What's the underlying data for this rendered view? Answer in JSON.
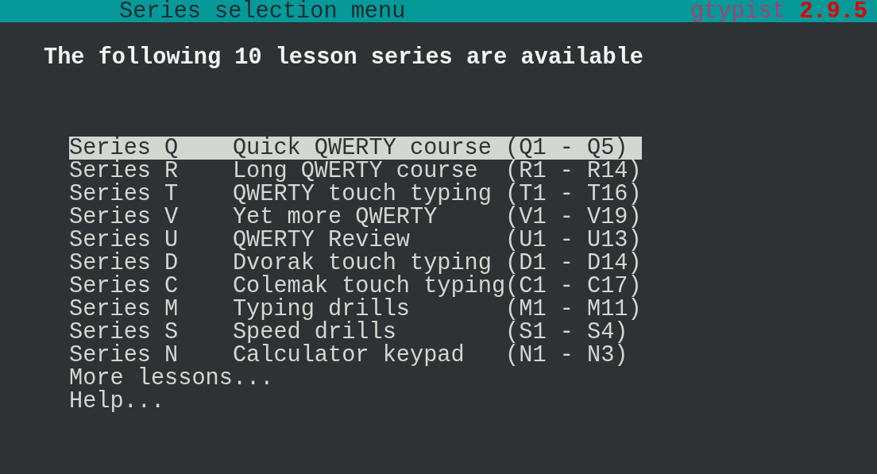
{
  "title_bar": {
    "title": "Series selection menu",
    "app_name": "gtypist",
    "version": "2.9.5"
  },
  "heading": "The following 10 lesson series are available",
  "menu": [
    {
      "kind": "series",
      "name": "Series Q",
      "description": "Quick QWERTY course",
      "range": "(Q1 - Q5)",
      "selected": true
    },
    {
      "kind": "series",
      "name": "Series R",
      "description": "Long QWERTY course",
      "range": "(R1 - R14)",
      "selected": false
    },
    {
      "kind": "series",
      "name": "Series T",
      "description": "QWERTY touch typing",
      "range": "(T1 - T16)",
      "selected": false
    },
    {
      "kind": "series",
      "name": "Series V",
      "description": "Yet more QWERTY",
      "range": "(V1 - V19)",
      "selected": false
    },
    {
      "kind": "series",
      "name": "Series U",
      "description": "QWERTY Review",
      "range": "(U1 - U13)",
      "selected": false
    },
    {
      "kind": "series",
      "name": "Series D",
      "description": "Dvorak touch typing",
      "range": "(D1 - D14)",
      "selected": false
    },
    {
      "kind": "series",
      "name": "Series C",
      "description": "Colemak touch typing",
      "range": "(C1 - C17)",
      "selected": false
    },
    {
      "kind": "series",
      "name": "Series M",
      "description": "Typing drills",
      "range": "(M1 - M11)",
      "selected": false
    },
    {
      "kind": "series",
      "name": "Series S",
      "description": "Speed drills",
      "range": "(S1 - S4)",
      "selected": false
    },
    {
      "kind": "series",
      "name": "Series N",
      "description": "Calculator keypad",
      "range": "(N1 - N3)",
      "selected": false
    },
    {
      "kind": "action",
      "label": "More lessons...",
      "selected": false
    },
    {
      "kind": "action",
      "label": "Help...",
      "selected": false
    }
  ]
}
